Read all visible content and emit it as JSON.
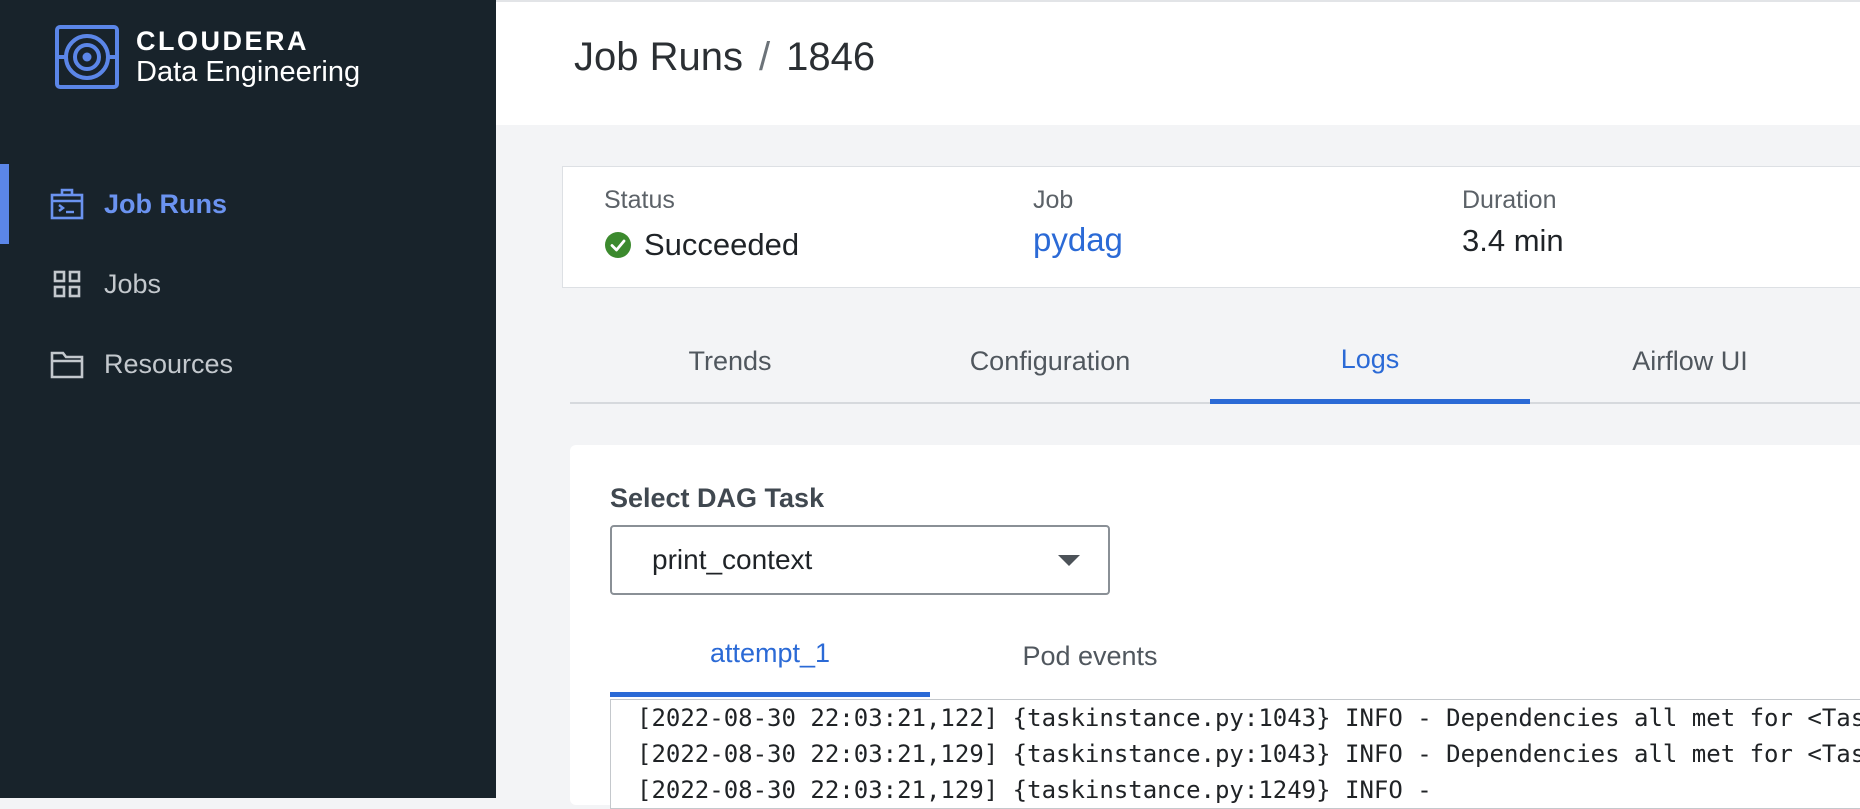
{
  "brand": {
    "name": "CLOUDERA",
    "product": "Data Engineering"
  },
  "sidebar": {
    "items": [
      {
        "label": "Job Runs",
        "icon": "job-runs-icon",
        "active": true
      },
      {
        "label": "Jobs",
        "icon": "grid-icon",
        "active": false
      },
      {
        "label": "Resources",
        "icon": "folder-icon",
        "active": false
      }
    ]
  },
  "header": {
    "breadcrumb_parent": "Job Runs",
    "separator": "/",
    "breadcrumb_current": "1846"
  },
  "summary": {
    "status_label": "Status",
    "status_value": "Succeeded",
    "job_label": "Job",
    "job_value": "pydag",
    "duration_label": "Duration",
    "duration_value": "3.4 min"
  },
  "tabs": [
    {
      "label": "Trends",
      "active": false
    },
    {
      "label": "Configuration",
      "active": false
    },
    {
      "label": "Logs",
      "active": true
    },
    {
      "label": "Airflow UI",
      "active": false
    }
  ],
  "logs": {
    "dag_label": "Select DAG Task",
    "dag_selected": "print_context",
    "subtabs": [
      {
        "label": "attempt_1",
        "active": true
      },
      {
        "label": "Pod events",
        "active": false
      }
    ],
    "lines": [
      "[2022-08-30 22:03:21,122] {taskinstance.py:1043} INFO - Dependencies all met for <Tas",
      "[2022-08-30 22:03:21,129] {taskinstance.py:1043} INFO - Dependencies all met for <Tas",
      "[2022-08-30 22:03:21,129] {taskinstance.py:1249} INFO -"
    ]
  },
  "colors": {
    "sidebar_bg": "#18232b",
    "accent": "#2b6ad6",
    "sidebar_accent": "#5b86e8",
    "success": "#3c8a2e"
  }
}
